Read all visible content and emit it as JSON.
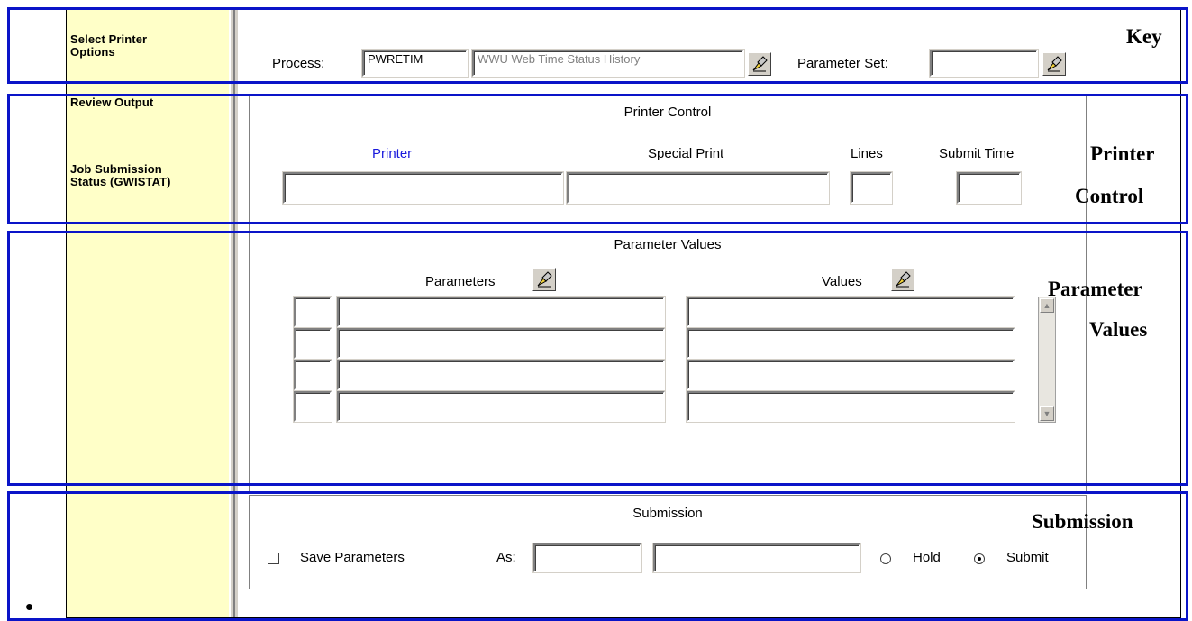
{
  "sidebar": {
    "items": [
      {
        "label": "Select Printer\nOptions"
      },
      {
        "label": "Review Output"
      },
      {
        "label": "Job Submission\nStatus (GWISTAT)"
      }
    ]
  },
  "key": {
    "process_label": "Process:",
    "process_code": "PWRETIM",
    "process_desc": "WWU Web Time Status History",
    "parameter_set_label": "Parameter Set:",
    "parameter_set_value": ""
  },
  "printer_control": {
    "title": "Printer Control",
    "printer_label": "Printer",
    "special_print_label": "Special Print",
    "lines_label": "Lines",
    "submit_time_label": "Submit Time",
    "printer_label_color": "#1a1adc"
  },
  "parameter_values": {
    "title": "Parameter Values",
    "parameters_label": "Parameters",
    "values_label": "Values",
    "rows": [
      {
        "num": "",
        "parameter": "",
        "value": ""
      },
      {
        "num": "",
        "parameter": "",
        "value": ""
      },
      {
        "num": "",
        "parameter": "",
        "value": ""
      },
      {
        "num": "",
        "parameter": "",
        "value": ""
      }
    ]
  },
  "submission": {
    "title": "Submission",
    "save_parameters_label": "Save Parameters",
    "save_parameters_checked": false,
    "as_label": "As:",
    "as_value_1": "",
    "as_value_2": "",
    "hold_label": "Hold",
    "submit_label": "Submit",
    "selected_mode": "Submit"
  },
  "annotations": {
    "key": "Key",
    "printer_control_1": "Printer",
    "printer_control_2": "Control",
    "parameter_values_1": "Parameter",
    "parameter_values_2": "Values",
    "submission": "Submission",
    "box_color": "#0a14c8"
  },
  "bullet": "•",
  "icons": {
    "lov": "flashlight-pointer-icon"
  }
}
